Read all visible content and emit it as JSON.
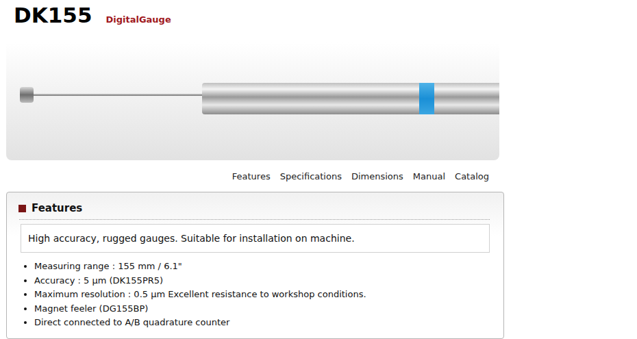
{
  "header": {
    "title": "DK155",
    "subtitle": "DigitalGauge"
  },
  "nav": [
    "Features",
    "Specifications",
    "Dimensions",
    "Manual",
    "Catalog"
  ],
  "features": {
    "heading": "Features",
    "summary": "High accuracy, rugged gauges. Suitable for installation on machine.",
    "items": [
      "Measuring range : 155 mm / 6.1\"",
      "Accuracy : 5 µm (DK155PR5)",
      "Maximum resolution : 0.5 µm Excellent resistance to workshop conditions.",
      "Magnet feeler (DG155BP)",
      "Direct connected to A/B quadrature counter"
    ]
  }
}
